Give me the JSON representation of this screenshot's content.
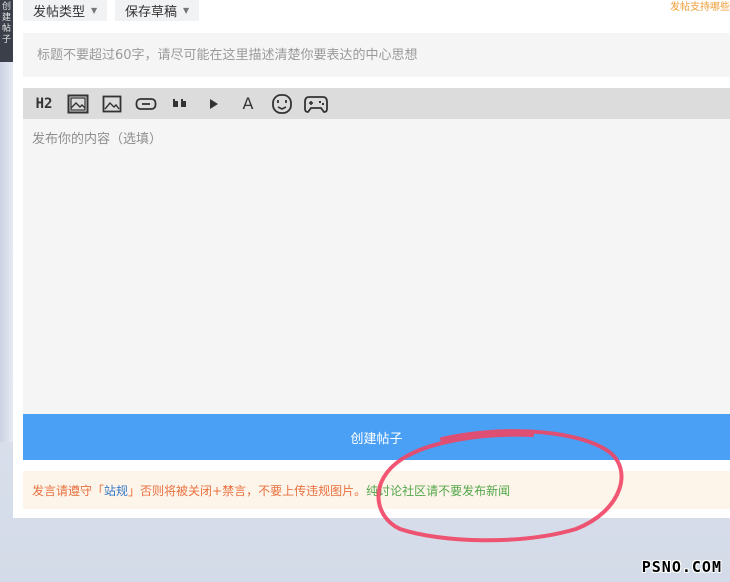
{
  "sidebar": {
    "vertical_text": [
      "创",
      "建",
      "帖",
      "子"
    ]
  },
  "header": {
    "post_type_label": "发帖类型",
    "save_draft_label": "保存草稿",
    "top_right_notice": "发帖支持哪些"
  },
  "form": {
    "title_placeholder": "标题不要超过60字，请尽可能在这里描述清楚你要表达的中心思想",
    "content_placeholder": "发布你的内容（选填）",
    "submit_label": "创建帖子"
  },
  "toolbar": {
    "buttons": [
      {
        "name": "heading",
        "glyph": "H2"
      },
      {
        "name": "image-insert",
        "glyph": ""
      },
      {
        "name": "image",
        "glyph": ""
      },
      {
        "name": "link",
        "glyph": ""
      },
      {
        "name": "quote",
        "glyph": ""
      },
      {
        "name": "play",
        "glyph": ""
      },
      {
        "name": "text-style",
        "glyph": "A"
      },
      {
        "name": "emoji",
        "glyph": ""
      },
      {
        "name": "game",
        "glyph": ""
      }
    ]
  },
  "rules": {
    "part1": "发言请遵守「",
    "link": "站规",
    "part2": "」否则将被关闭+禁言，不要上传违规图片。",
    "part3": "纯讨论社区请不要发布新闻"
  },
  "watermark": "PSNO.COM",
  "colors": {
    "submit_bg": "#4aa0f5",
    "annotation": "#f04565",
    "warn_text": "#e8703f",
    "ok_text": "#53a64a"
  }
}
